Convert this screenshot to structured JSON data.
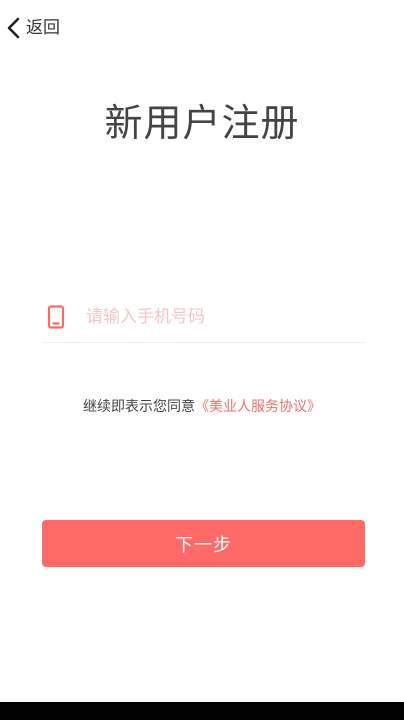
{
  "nav": {
    "back_label": "返回"
  },
  "page": {
    "title": "新用户注册"
  },
  "phone_field": {
    "placeholder": "请输入手机号码",
    "value": ""
  },
  "agreement": {
    "prefix": "继续即表示您同意",
    "link_text": "《美业人服务协议》"
  },
  "actions": {
    "next_label": "下一步"
  },
  "colors": {
    "accent": "#ff6a67",
    "link": "#f0706b",
    "placeholder": "#f3c6c6"
  },
  "icons": {
    "back": "chevron-left-icon",
    "phone": "mobile-phone-icon"
  }
}
